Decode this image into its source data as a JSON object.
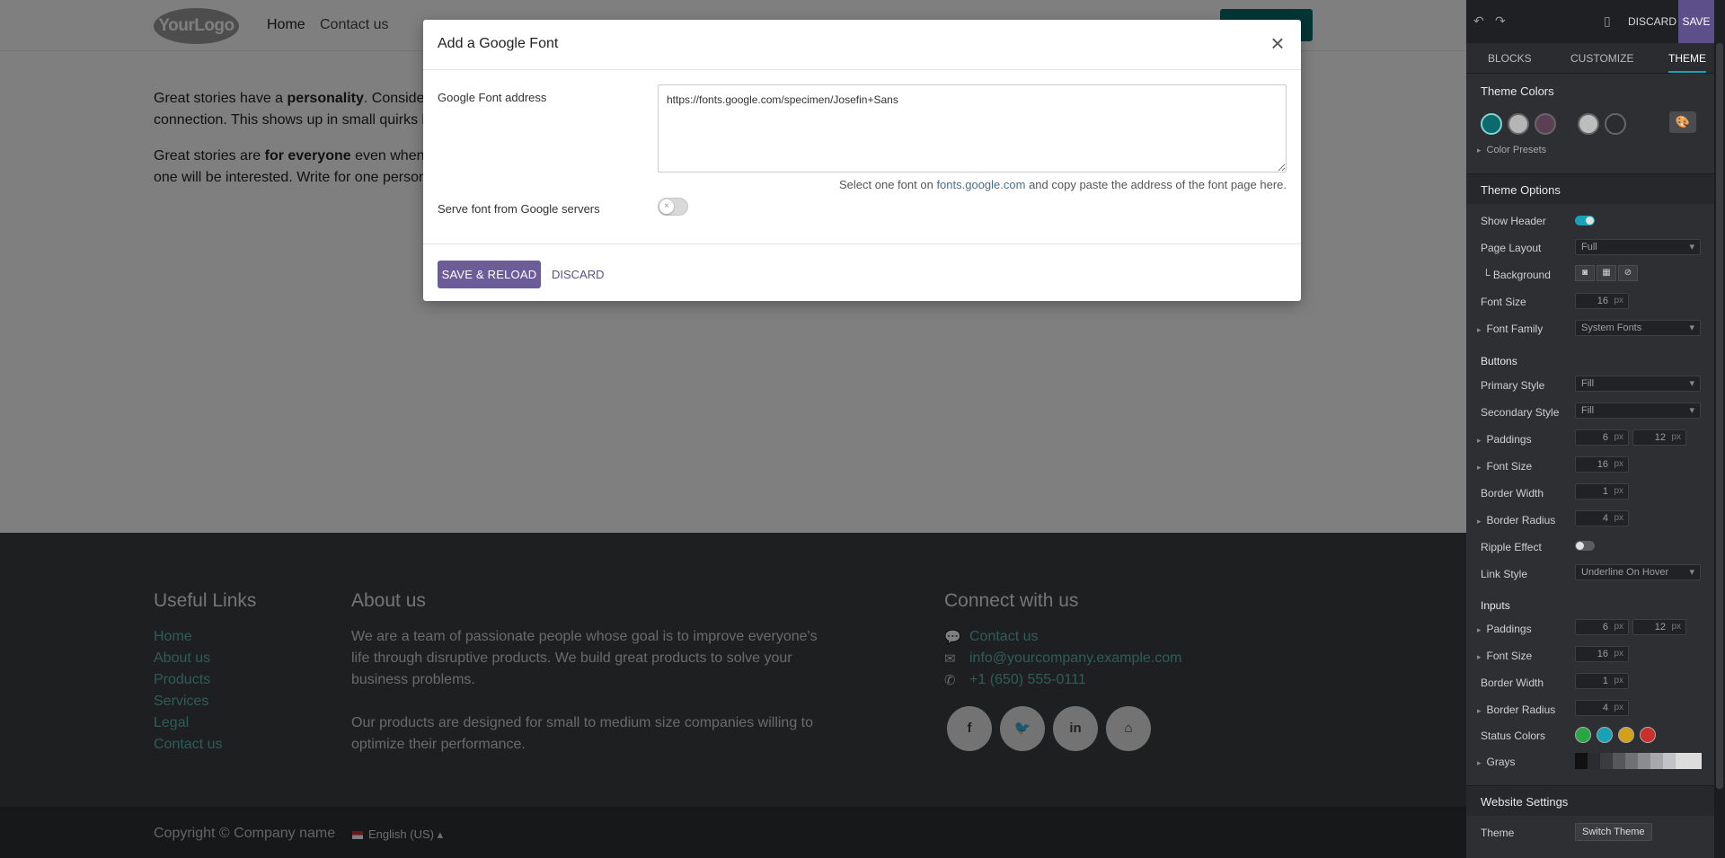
{
  "site": {
    "logo": "YourLogo",
    "nav": {
      "home": "Home",
      "contact": "Contact us"
    },
    "content": {
      "p1_start": "Great stories have a ",
      "p1_bold": "personality",
      "p1_end": ". Consider",
      "p1_line2": "connection. This shows up in small quirks l",
      "p2_start": "Great stories are ",
      "p2_bold": "for everyone",
      "p2_end": " even when",
      "p2_line2": "one will be interested. Write for one person"
    },
    "footer": {
      "useful_links_title": "Useful Links",
      "links": [
        "Home",
        "About us",
        "Products",
        "Services",
        "Legal",
        "Contact us"
      ],
      "about_title": "About us",
      "about_p1": "We are a team of passionate people whose goal is to improve everyone's life through disruptive products. We build great products to solve your business problems.",
      "about_p2": "Our products are designed for small to medium size companies willing to optimize their performance.",
      "connect_title": "Connect with us",
      "contact_link": "Contact us",
      "email": "info@yourcompany.example.com",
      "phone": "+1 (650) 555-0111",
      "social": [
        "f",
        "t",
        "in",
        "home"
      ]
    },
    "copyright": "Copyright © Company name",
    "language": "English (US)"
  },
  "modal": {
    "title": "Add a Google Font",
    "close_label": "×",
    "address_label": "Google Font address",
    "address_value": "https://fonts.google.com/specimen/Josefin+Sans",
    "help_start": "Select one font on ",
    "help_link": "fonts.google.com",
    "help_end": " and copy paste the address of the font page here.",
    "serve_label": "Serve font from Google servers",
    "serve_enabled": false,
    "save_reload": "SAVE & RELOAD",
    "discard": "DISCARD"
  },
  "panel": {
    "topbar": {
      "discard": "DISCARD",
      "save": "SAVE"
    },
    "tabs": [
      "BLOCKS",
      "CUSTOMIZE",
      "THEME"
    ],
    "active_tab": "THEME",
    "theme_colors": {
      "title": "Theme Colors",
      "colors": [
        "#0c6a6c",
        "#b5b5b5",
        "#5c3f55",
        "#bdbdbd",
        "#2a2c30"
      ],
      "presets": "Color Presets"
    },
    "theme_options": {
      "title": "Theme Options",
      "show_header": "Show Header",
      "show_header_on": true,
      "page_layout": "Page Layout",
      "page_layout_value": "Full",
      "background": "Background",
      "font_size": "Font Size",
      "font_size_value": "16",
      "font_family": "Font Family",
      "font_family_value": "System Fonts"
    },
    "buttons": {
      "title": "Buttons",
      "primary_style": "Primary Style",
      "primary_value": "Fill",
      "secondary_style": "Secondary Style",
      "secondary_value": "Fill",
      "paddings": "Paddings",
      "pad_y": "6",
      "pad_x": "12",
      "font_size": "Font Size",
      "font_size_value": "16",
      "border_width": "Border Width",
      "border_width_value": "1",
      "border_radius": "Border Radius",
      "border_radius_value": "4",
      "ripple": "Ripple Effect",
      "ripple_on": false,
      "link_style": "Link Style",
      "link_style_value": "Underline On Hover"
    },
    "inputs": {
      "title": "Inputs",
      "paddings": "Paddings",
      "pad_y": "6",
      "pad_x": "12",
      "font_size": "Font Size",
      "font_size_value": "16",
      "border_width": "Border Width",
      "border_width_value": "1",
      "border_radius": "Border Radius",
      "border_radius_value": "4",
      "status_colors": "Status Colors",
      "status": [
        "#28a745",
        "#17a2b8",
        "#d4a017",
        "#c9302c"
      ],
      "grays": "Grays"
    },
    "website_settings": {
      "title": "Website Settings",
      "theme": "Theme",
      "switch_theme": "Switch Theme"
    },
    "px": "px"
  }
}
